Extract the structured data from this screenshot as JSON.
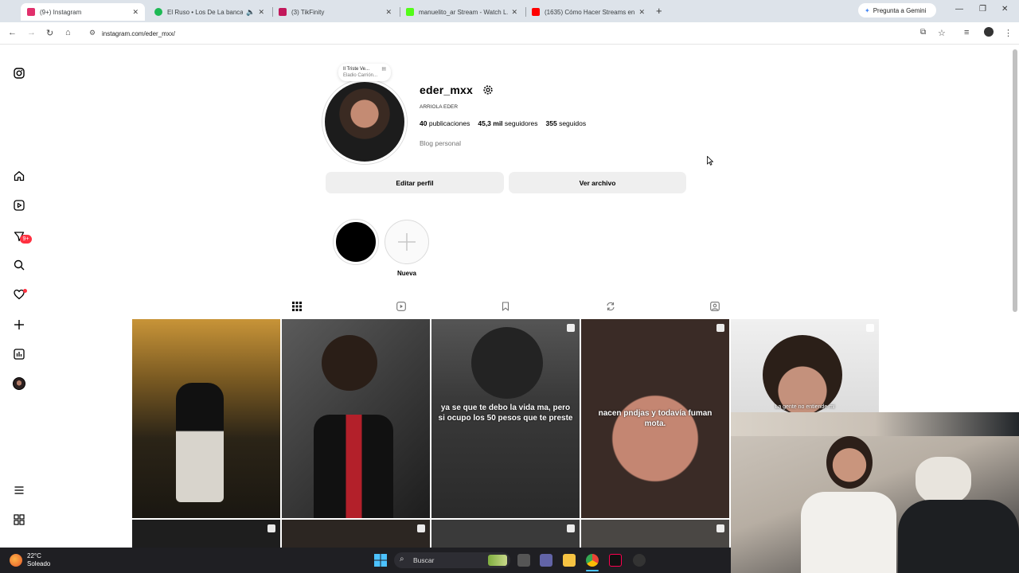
{
  "browser": {
    "tabs": [
      {
        "title": "(9+) Instagram",
        "color": "#e1306c",
        "audio": false
      },
      {
        "title": "El Ruso • Los De La banca",
        "color": "#1db954",
        "audio": true
      },
      {
        "title": "(3) TikFinity",
        "color": "#c2185b",
        "audio": false
      },
      {
        "title": "manuelito_ar Stream - Watch L…",
        "color": "#53fc18",
        "audio": false
      },
      {
        "title": "(1635) Cómo Hacer Streams en…",
        "color": "#ff0000",
        "audio": false
      }
    ],
    "new_tab_label": "+",
    "gemini_label": "Pregunta a Gemini",
    "url": "instagram.com/eder_mxx/"
  },
  "profile": {
    "username": "eder_mxx",
    "full_name": "ARRIOLA EDER",
    "posts": "40",
    "posts_label": "publicaciones",
    "followers": "45,3 mil",
    "followers_label": "seguidores",
    "following": "355",
    "following_label": "seguidos",
    "category": "Blog personal",
    "note_line1": "Il Triste Ve...",
    "note_line2": "Eladio Carrión...",
    "edit_button": "Editar perfil",
    "archive_button": "Ver archivo",
    "new_highlight_label": "Nueva"
  },
  "posts": [
    {
      "caption": "",
      "reel": false,
      "bg": "#5b4a2e"
    },
    {
      "caption": "",
      "reel": false,
      "bg": "#4a4a4a"
    },
    {
      "caption": "ya se que te debo la vida ma, pero si ocupo los 50 pesos que te preste",
      "reel": true,
      "bg": "#3b3b3b"
    },
    {
      "caption": "nacen pndjas y todavía fuman mota.",
      "reel": true,
      "bg": "#4b3b35"
    },
    {
      "caption": "La gente no entiende mi",
      "reel": true,
      "bg": "#e6e6e6"
    }
  ],
  "taskbar": {
    "temperature": "22°C",
    "weather": "Soleado",
    "search_placeholder": "Buscar"
  },
  "sidebar_badge": "9+"
}
